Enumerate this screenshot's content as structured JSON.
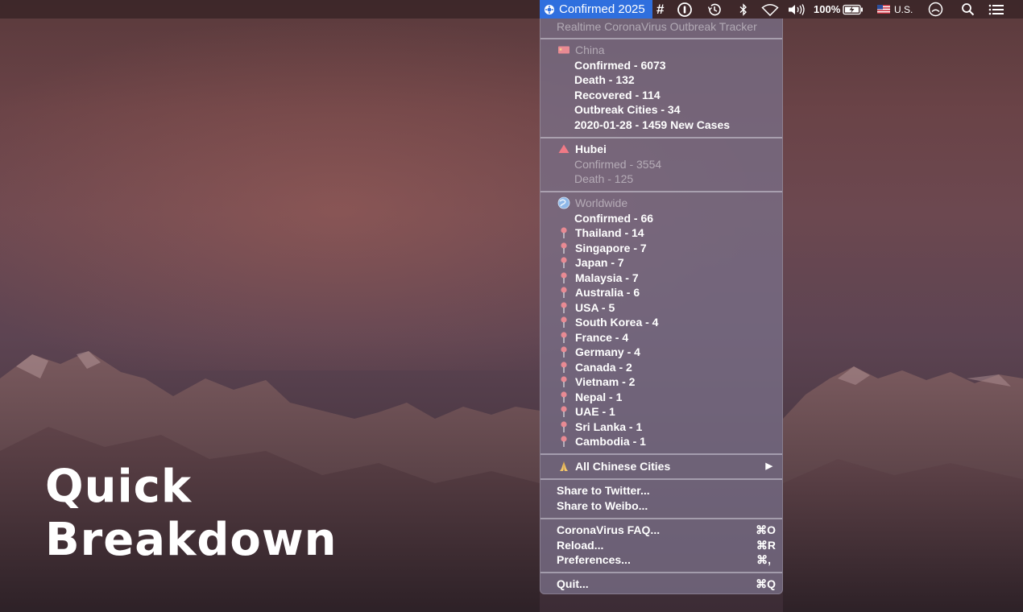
{
  "menubar": {
    "active_item": "Confirmed 2025",
    "hash_label": "#",
    "battery": "100%",
    "input_source": "U.S."
  },
  "menu": {
    "header": "Realtime CoronaVirus Outbreak Tracker",
    "china": {
      "title": "China",
      "confirmed": "Confirmed - 6073",
      "death": "Death - 132",
      "recovered": "Recovered - 114",
      "cities": "Outbreak Cities - 34",
      "new_cases": "2020-01-28 - 1459 New Cases"
    },
    "hubei": {
      "title": "Hubei",
      "confirmed": "Confirmed - 3554",
      "death": "Death - 125"
    },
    "worldwide": {
      "title": "Worldwide",
      "confirmed": "Confirmed - 66",
      "countries": [
        "Thailand - 14",
        "Singapore - 7",
        "Japan - 7",
        "Malaysia - 7",
        "Australia - 6",
        "USA - 5",
        "South Korea - 4",
        "France - 4",
        "Germany - 4",
        "Canada - 2",
        "Vietnam - 2",
        "Nepal - 1",
        "UAE - 1",
        "Sri Lanka - 1",
        "Cambodia - 1"
      ]
    },
    "all_cities": "All Chinese Cities",
    "share_twitter": "Share to Twitter...",
    "share_weibo": "Share to Weibo...",
    "faq": "CoronaVirus FAQ...",
    "faq_shortcut": "⌘O",
    "reload": "Reload...",
    "reload_shortcut": "⌘R",
    "preferences": "Preferences...",
    "preferences_shortcut": "⌘,",
    "quit": "Quit...",
    "quit_shortcut": "⌘Q"
  },
  "overlay": {
    "line1": "Quick",
    "line2": "Breakdown"
  },
  "colors": {
    "menubar_active": "#2f6fde",
    "menu_bg": "#786e87",
    "pin": "#e88a93"
  },
  "icons": {
    "china": "china-flag-icon",
    "hubei": "warning-triangle-icon",
    "worldwide": "globe-icon",
    "country": "pushpin-icon",
    "cities": "praying-hands-icon"
  }
}
